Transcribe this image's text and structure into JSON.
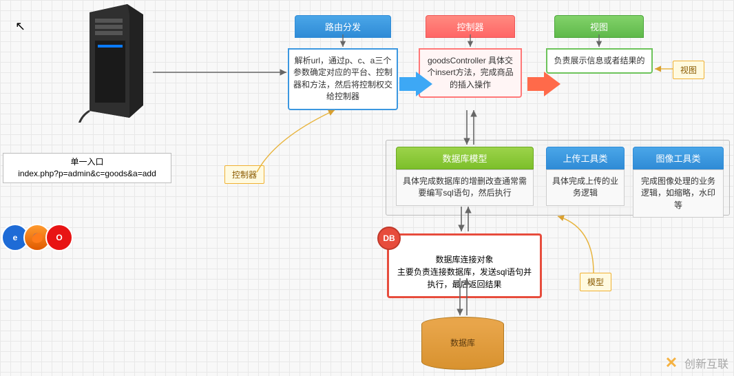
{
  "entry": {
    "title": "单一入口",
    "url": "index.php?p=admin&c=goods&a=add"
  },
  "router": {
    "title": "路由分发",
    "body": "解析url，通过p、c、a三个参数确定对应的平台、控制器和方法，然后将控制权交给控制器"
  },
  "controller": {
    "title": "控制器",
    "body": "goodsController 具体交个insert方法，完成商品的插入操作"
  },
  "view": {
    "title": "视图",
    "body": "负责展示信息或者结果的"
  },
  "model": {
    "title": "数据库模型",
    "body": "具体完成数据库的增删改查通常需要编写sql语句，然后执行"
  },
  "upload": {
    "title": "上传工具类",
    "body": "具体完成上传的业务逻辑"
  },
  "image": {
    "title": "图像工具类",
    "body": "完成图像处理的业务逻辑，如缩略，水印等"
  },
  "db": {
    "badge": "DB",
    "body": "数据库连接对象\n主要负责连接数据库，发送sql语句并执行，最后返回结果"
  },
  "cylinder": {
    "label": "数据库"
  },
  "labels": {
    "controller": "控制器",
    "view": "视图",
    "model": "模型"
  },
  "watermark": "创新互联"
}
